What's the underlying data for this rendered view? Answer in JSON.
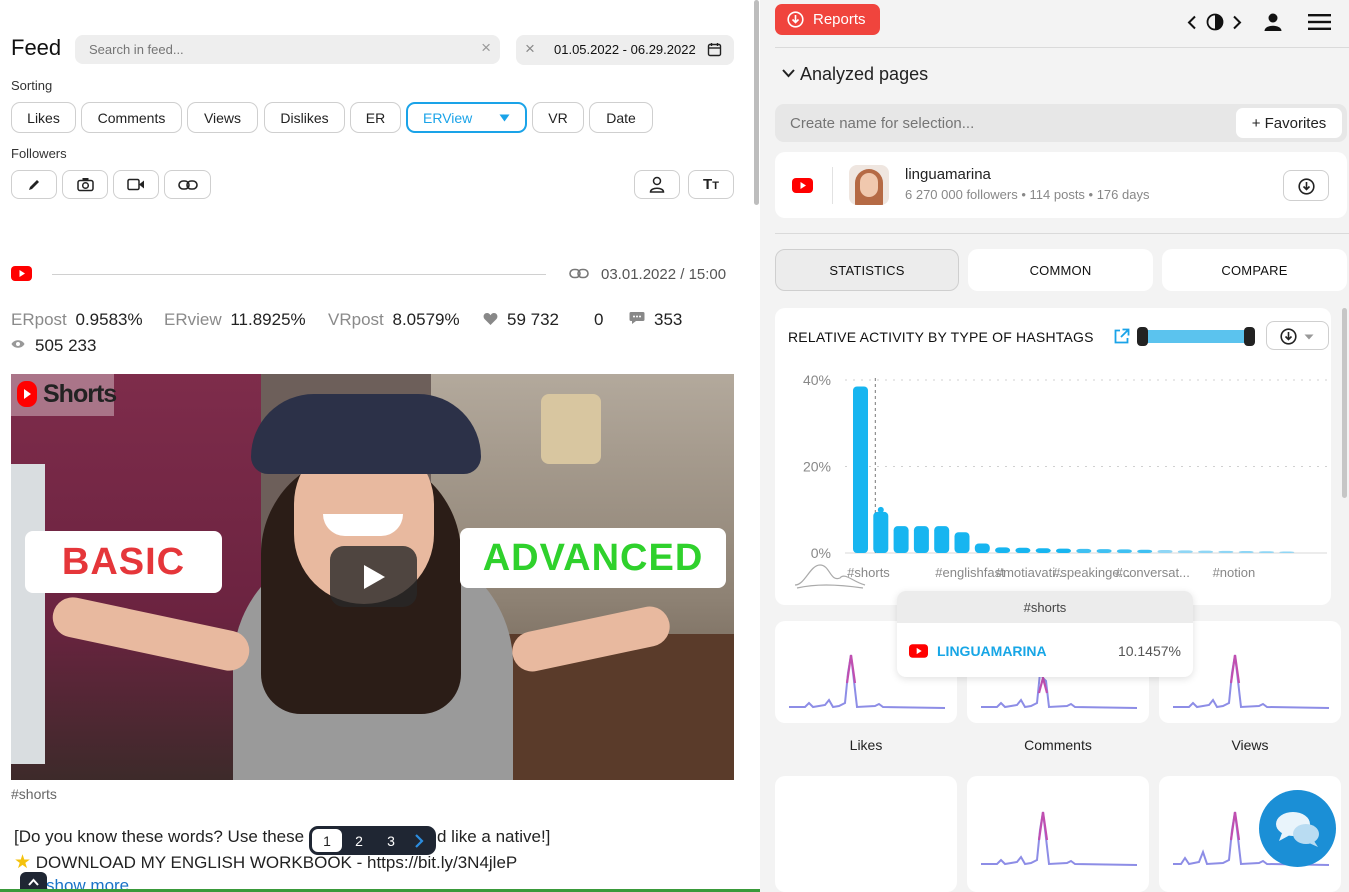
{
  "feed": {
    "title": "Feed",
    "search_placeholder": "Search in feed...",
    "date_range": "01.05.2022 - 06.29.2022",
    "sorting_label": "Sorting",
    "sort_options": [
      "Likes",
      "Comments",
      "Views",
      "Dislikes",
      "ER",
      "ERView",
      "VR",
      "Date"
    ],
    "active_sort": "ERView",
    "followers_label": "Followers"
  },
  "post": {
    "datetime": "03.01.2022 / 15:00",
    "metrics": {
      "erpost_label": "ERpost",
      "erpost": "0.9583%",
      "erview_label": "ERview",
      "erview": "11.8925%",
      "vrpost_label": "VRpost",
      "vrpost": "8.0579%",
      "likes": "59 732",
      "dislikes": "0",
      "comments": "353",
      "views": "505 233"
    },
    "thumbnail": {
      "shorts_label": "Shorts",
      "left_caption": "BASIC",
      "right_caption": "ADVANCED"
    },
    "hashtag": "#shorts",
    "desc_line1": "[Do you know these words? Use these",
    "desc_line1_end": "d like a native!]",
    "desc_line2": "DOWNLOAD MY ENGLISH WORKBOOK - https://bit.ly/3N4jleP",
    "show_more": "show more"
  },
  "pagination": {
    "pages": [
      "1",
      "2",
      "3"
    ],
    "current": "1"
  },
  "right": {
    "reports_label": "Reports",
    "analyzed_pages_label": "Analyzed pages",
    "selection_placeholder": "Create name for selection...",
    "favorites_label": "+ Favorites",
    "account": {
      "name": "linguamarina",
      "stats": "6 270 000 followers • 114 posts • 176 days"
    },
    "tabs": [
      "STATISTICS",
      "COMMON",
      "COMPARE"
    ],
    "active_tab": "STATISTICS",
    "chart_title": "RELATIVE ACTIVITY BY TYPE OF HASHTAGS",
    "tooltip": {
      "hashtag": "#shorts",
      "account": "LINGUAMARINA",
      "value": "10.1457%"
    },
    "mini_labels": [
      "Likes",
      "Comments",
      "Views"
    ]
  },
  "colors": {
    "accent": "#1aa3e8",
    "bar": "#17b5f0",
    "reports": "#f0443d",
    "youtube": "#ff0000",
    "spark": "#8d8de6",
    "spark_peak": "#c04fb0",
    "chat": "#1b8fd6"
  },
  "chart_data": {
    "type": "bar",
    "categories": [
      "#shorts",
      "",
      "",
      "",
      "",
      "#englishfast",
      "",
      "",
      "#motiavati...",
      "",
      "",
      "#speakinge...",
      "",
      "",
      "#conversat...",
      "",
      "",
      "",
      "#notion",
      "",
      "",
      ""
    ],
    "values": [
      38.5,
      9.5,
      6.2,
      6.2,
      6.2,
      4.8,
      2.2,
      1.3,
      1.2,
      1.1,
      1.0,
      0.95,
      0.9,
      0.85,
      0.75,
      0.7,
      0.6,
      0.55,
      0.5,
      0.45,
      0.4,
      0.35
    ],
    "yticks": [
      "40%",
      "20%",
      "0%"
    ],
    "ylim": [
      0,
      40
    ],
    "grid": true
  }
}
